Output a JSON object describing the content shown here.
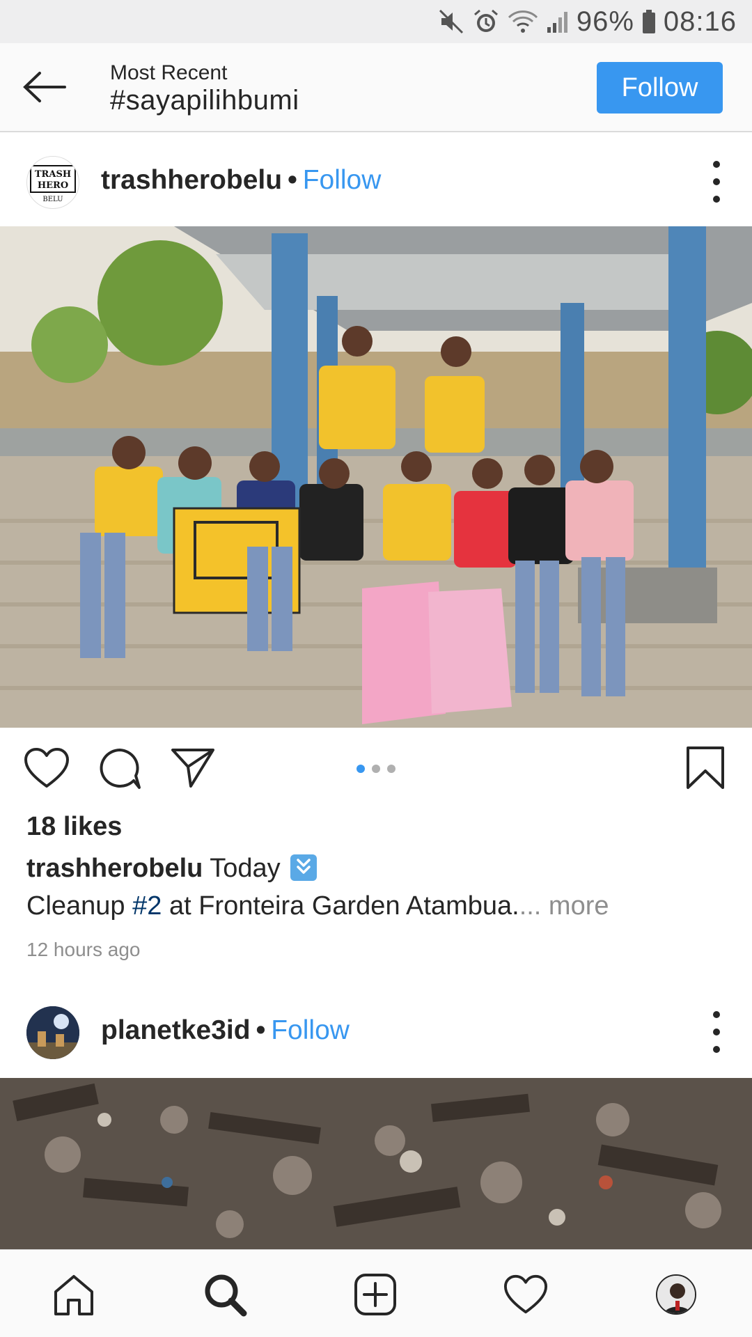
{
  "status_bar": {
    "battery": "96%",
    "time": "08:16",
    "icons": [
      "mute-icon",
      "alarm-icon",
      "wifi-icon",
      "signal-icon",
      "battery-icon"
    ]
  },
  "header": {
    "subtitle": "Most Recent",
    "title": "#sayapilihbumi",
    "follow_label": "Follow"
  },
  "posts": [
    {
      "username": "trashherobelu",
      "follow_label": "Follow",
      "avatar_text": [
        "TRASH",
        "HERO",
        "BELU"
      ],
      "likes": "18 likes",
      "caption_user": "trashherobelu",
      "caption_text": "Today",
      "caption_line2_prefix": "Cleanup ",
      "caption_tag": "#2",
      "caption_line2_rest": " at Fronteira Garden Atambua.",
      "more_label": "... more",
      "time_ago": "12 hours ago",
      "carousel": {
        "count": 3,
        "active": 0
      }
    },
    {
      "username": "planetke3id",
      "follow_label": "Follow"
    }
  ],
  "colors": {
    "accent": "#3897f0",
    "text": "#262626",
    "muted": "#8e8e8e",
    "hashtag": "#003569"
  }
}
